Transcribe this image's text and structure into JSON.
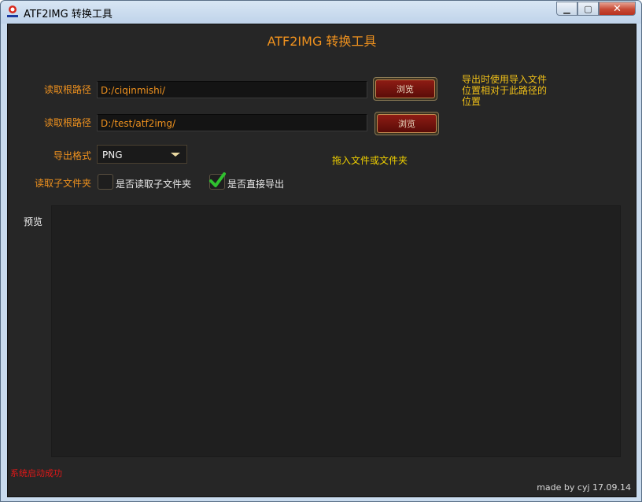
{
  "window": {
    "title": "ATF2IMG 转换工具",
    "icon": "app-logo-icon",
    "controls": {
      "minimize": "minimize-icon",
      "maximize": "maximize-icon",
      "close": "close-icon"
    }
  },
  "heading": "ATF2IMG 转换工具",
  "read_path": {
    "label": "读取根路径",
    "value": "D:/ciqinmishi/",
    "browse_label": "浏览"
  },
  "export_path": {
    "label": "读取根路径",
    "value": "D:/test/atf2img/",
    "browse_label": "浏览"
  },
  "path_note": "导出时使用导入文件位置相对于此路径的位置",
  "export_format": {
    "label": "导出格式",
    "selected": "PNG"
  },
  "drop_hint": "拖入文件或文件夹",
  "subfolders": {
    "label": "读取子文件夹",
    "read_subfolders": {
      "label": "是否读取子文件夹",
      "checked": false
    },
    "direct_export": {
      "label": "是否直接导出",
      "checked": true
    }
  },
  "preview": {
    "label": "预览"
  },
  "status": "系统启动成功",
  "credit": "made by cyj 17.09.14",
  "colors": {
    "label_orange": "#f0921e",
    "note_yellow": "#f0c018",
    "status_red": "#e01818",
    "check_green": "#2fc12f",
    "browse_red": "#8e1c14"
  }
}
